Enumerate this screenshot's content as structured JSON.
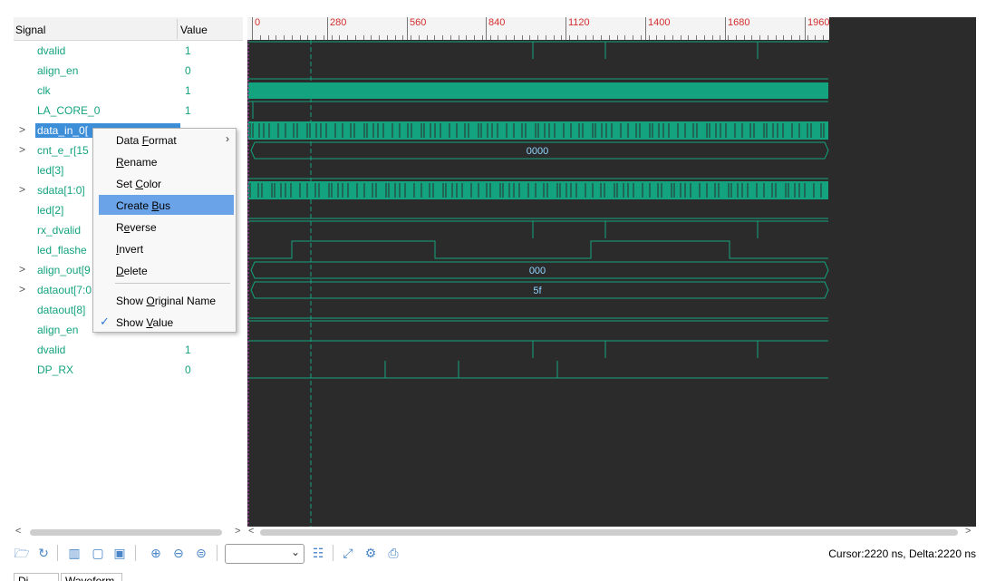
{
  "signal_panel": {
    "header_signal": "Signal",
    "header_value": "Value",
    "rows": [
      {
        "name": "dvalid",
        "value": "1",
        "expandable": false
      },
      {
        "name": "align_en",
        "value": "0",
        "expandable": false
      },
      {
        "name": "clk",
        "value": "1",
        "expandable": false
      },
      {
        "name": "LA_CORE_0",
        "value": "1",
        "expandable": false
      },
      {
        "name": "data_in_0[",
        "value": "",
        "expandable": true
      },
      {
        "name": "cnt_e_r[15",
        "value": "",
        "expandable": true
      },
      {
        "name": "led[3]",
        "value": "",
        "expandable": false
      },
      {
        "name": "sdata[1:0]",
        "value": "",
        "expandable": true
      },
      {
        "name": "led[2]",
        "value": "",
        "expandable": false
      },
      {
        "name": "rx_dvalid",
        "value": "",
        "expandable": false
      },
      {
        "name": "led_flashe",
        "value": "",
        "expandable": false
      },
      {
        "name": "align_out[9",
        "value": "",
        "expandable": true
      },
      {
        "name": "dataout[7:0",
        "value": "",
        "expandable": true
      },
      {
        "name": "dataout[8]",
        "value": "",
        "expandable": false
      },
      {
        "name": "align_en",
        "value": "",
        "expandable": false
      },
      {
        "name": "dvalid",
        "value": "1",
        "expandable": false
      },
      {
        "name": "DP_RX",
        "value": "0",
        "expandable": false
      }
    ]
  },
  "ruler": {
    "labels": [
      "0",
      "280",
      "560",
      "840",
      "1120",
      "1400",
      "1680",
      "1960"
    ]
  },
  "bus_values": {
    "cnt_e_r": "0000",
    "align_out": "000",
    "dataout": "5f"
  },
  "context_menu": {
    "items": [
      {
        "label": "Data Format",
        "has_submenu": true
      },
      {
        "label": "Rename"
      },
      {
        "label": "Set Color"
      },
      {
        "label": "Create Bus",
        "highlighted": true
      },
      {
        "label": "Reverse"
      },
      {
        "label": "Invert"
      },
      {
        "label": "Delete"
      },
      {
        "label": "Show Original Name"
      },
      {
        "label": "Show Value",
        "checked": true
      }
    ]
  },
  "toolbar": {
    "icons": [
      "open-icon",
      "refresh-icon",
      "list-icon",
      "trash-icon",
      "save-icon",
      "zoom-in-icon",
      "zoom-out-icon",
      "zoom-fit-icon",
      "find-icon",
      "expand-icon",
      "settings-icon",
      "print-icon"
    ],
    "zoom_value": ""
  },
  "status": {
    "text": "Cursor:2220 ns, Delta:2220 ns"
  },
  "bottom_tabs": [
    "Di...",
    "Waveform"
  ],
  "colors": {
    "wave": "#14a37f",
    "wave_background": "#2b2b2b",
    "ruler_label": "#d32f2f",
    "selection": "#3d8ed8",
    "menu_highlight": "#6ba3e8"
  }
}
